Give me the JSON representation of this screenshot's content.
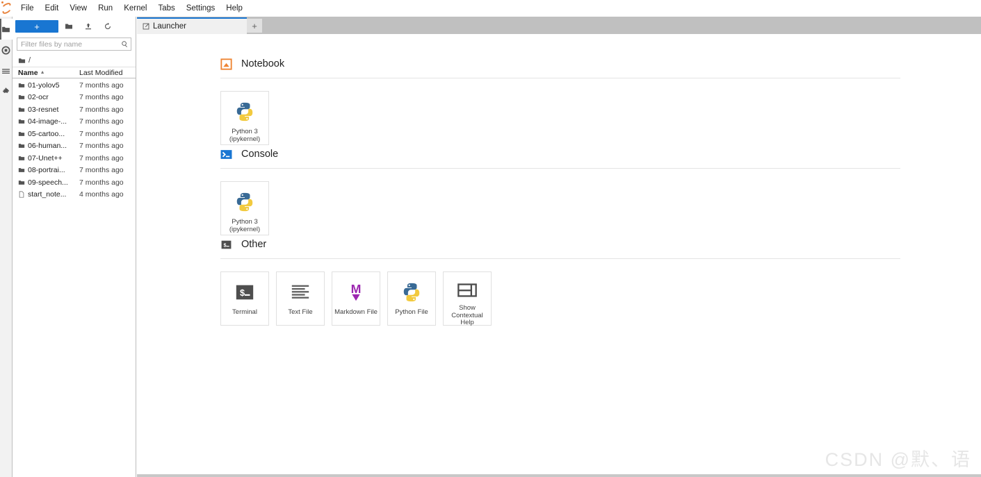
{
  "app": {
    "logo_icon": "jupyter-logo",
    "menu": [
      "File",
      "Edit",
      "View",
      "Run",
      "Kernel",
      "Tabs",
      "Settings",
      "Help"
    ]
  },
  "activity_bar": {
    "items": [
      {
        "name": "file-browser",
        "icon": "folder-icon",
        "active": true
      },
      {
        "name": "running-terminals-kernels",
        "icon": "stop-circle-icon",
        "active": false
      },
      {
        "name": "command-palette",
        "icon": "list-icon",
        "active": false
      },
      {
        "name": "extension-manager",
        "icon": "puzzle-icon",
        "active": false
      }
    ]
  },
  "file_browser": {
    "toolbar": {
      "new_launcher_label": "+",
      "new_folder_icon": "new-folder-icon",
      "upload_icon": "upload-icon",
      "refresh_icon": "refresh-icon"
    },
    "filter_placeholder": "Filter files by name",
    "filter_value": "",
    "search_icon": "search-icon",
    "breadcrumb": "/",
    "breadcrumb_icon": "folder-icon",
    "columns": {
      "name": "Name",
      "last_modified": "Last Modified"
    },
    "sort_caret": "▲",
    "files": [
      {
        "name": "01-yolov5",
        "modified": "7 months ago",
        "type": "folder"
      },
      {
        "name": "02-ocr",
        "modified": "7 months ago",
        "type": "folder"
      },
      {
        "name": "03-resnet",
        "modified": "7 months ago",
        "type": "folder"
      },
      {
        "name": "04-image-...",
        "modified": "7 months ago",
        "type": "folder"
      },
      {
        "name": "05-cartoo...",
        "modified": "7 months ago",
        "type": "folder"
      },
      {
        "name": "06-human...",
        "modified": "7 months ago",
        "type": "folder"
      },
      {
        "name": "07-Unet++",
        "modified": "7 months ago",
        "type": "folder"
      },
      {
        "name": "08-portrai...",
        "modified": "7 months ago",
        "type": "folder"
      },
      {
        "name": "09-speech...",
        "modified": "7 months ago",
        "type": "folder"
      },
      {
        "name": "start_note...",
        "modified": "4 months ago",
        "type": "file"
      }
    ]
  },
  "tabs": {
    "open": [
      {
        "label": "Launcher",
        "icon": "launcher-icon",
        "active": true
      }
    ],
    "add_label": "+"
  },
  "launcher": {
    "sections": [
      {
        "title": "Notebook",
        "icon": "notebook-icon",
        "cards": [
          {
            "label": "Python 3\n(ipykernel)",
            "line1": "Python 3",
            "line2": "(ipykernel)",
            "icon": "python-icon"
          }
        ]
      },
      {
        "title": "Console",
        "icon": "console-icon",
        "cards": [
          {
            "label": "Python 3\n(ipykernel)",
            "line1": "Python 3",
            "line2": "(ipykernel)",
            "icon": "python-icon"
          }
        ]
      },
      {
        "title": "Other",
        "icon": "terminal-icon",
        "cards": [
          {
            "line1": "Terminal",
            "line2": "",
            "line3": "",
            "icon": "terminal-icon"
          },
          {
            "line1": "Text File",
            "line2": "",
            "line3": "",
            "icon": "text-file-icon"
          },
          {
            "line1": "Markdown File",
            "line2": "",
            "line3": "",
            "icon": "markdown-icon"
          },
          {
            "line1": "Python File",
            "line2": "",
            "line3": "",
            "icon": "python-icon"
          },
          {
            "line1": "Show",
            "line2": "Contextual",
            "line3": "Help",
            "icon": "contextual-help-icon"
          }
        ]
      }
    ]
  },
  "watermark": {
    "text": "CSDN @默、语"
  },
  "colors": {
    "accent_blue": "#1976d2",
    "tabbar_gray": "#c0c0c0",
    "notebook_orange": "#ee8432",
    "console_blue": "#1976d2",
    "terminal_dark": "#4e4e4e",
    "markdown_purple": "#9c27b0",
    "python_blue": "#396a95",
    "python_yellow": "#f2ca3f"
  }
}
